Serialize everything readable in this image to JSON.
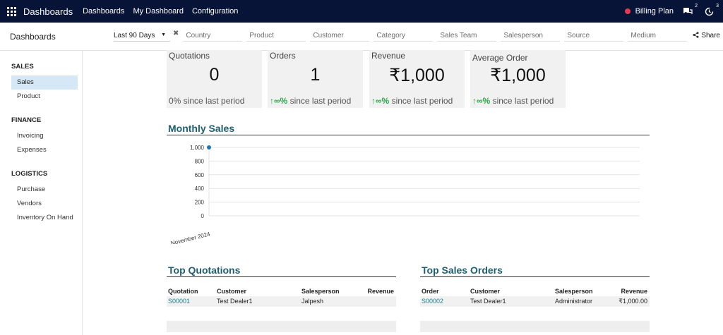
{
  "navbar": {
    "brand": "Dashboards",
    "menu": [
      "Dashboards",
      "My Dashboard",
      "Configuration"
    ],
    "billing_label": "Billing Plan",
    "messages_count": "2",
    "activity_count": "3"
  },
  "control_panel": {
    "title": "Dashboards",
    "period": "Last 90 Days",
    "filters": [
      "Country",
      "Product",
      "Customer",
      "Category",
      "Sales Team",
      "Salesperson",
      "Source",
      "Medium"
    ],
    "share_label": "Share"
  },
  "sidebar": {
    "sections": [
      {
        "title": "SALES",
        "items": [
          "Sales",
          "Product"
        ]
      },
      {
        "title": "FINANCE",
        "items": [
          "Invoicing",
          "Expenses"
        ]
      },
      {
        "title": "LOGISTICS",
        "items": [
          "Purchase",
          "Vendors",
          "Inventory On Hand"
        ]
      }
    ],
    "active_item": "Sales"
  },
  "kpis": [
    {
      "title": "Quotations",
      "value": "0",
      "trend": "",
      "footer": "0% since last period"
    },
    {
      "title": "Orders",
      "value": "1",
      "trend": "↑∞%",
      "footer": " since last period"
    },
    {
      "title": "Revenue",
      "value": "₹1,000",
      "trend": "↑∞%",
      "footer": " since last period"
    },
    {
      "title": "Average Order",
      "value": "₹1,000",
      "trend": "↑∞%",
      "footer": " since last period"
    }
  ],
  "monthly_sales": {
    "title": "Monthly Sales"
  },
  "chart_data": {
    "type": "line",
    "title": "Monthly Sales",
    "categories": [
      "November 2024"
    ],
    "series": [
      {
        "values": [
          1000
        ]
      }
    ],
    "yticks": [
      "1,000",
      "800",
      "600",
      "400",
      "200",
      "0"
    ],
    "ylim": [
      0,
      1000
    ],
    "grid": true,
    "color": "#1f77b4"
  },
  "top_quotations": {
    "title": "Top Quotations",
    "columns": [
      "Quotation",
      "Customer",
      "Salesperson",
      "Revenue"
    ],
    "rows": [
      [
        "S00001",
        "Test Dealer1",
        "Jalpesh",
        ""
      ]
    ]
  },
  "top_sales_orders": {
    "title": "Top Sales Orders",
    "columns": [
      "Order",
      "Customer",
      "Salesperson",
      "Revenue"
    ],
    "rows": [
      [
        "S00002",
        "Test Dealer1",
        "Administrator",
        "₹1,000.00"
      ]
    ]
  }
}
